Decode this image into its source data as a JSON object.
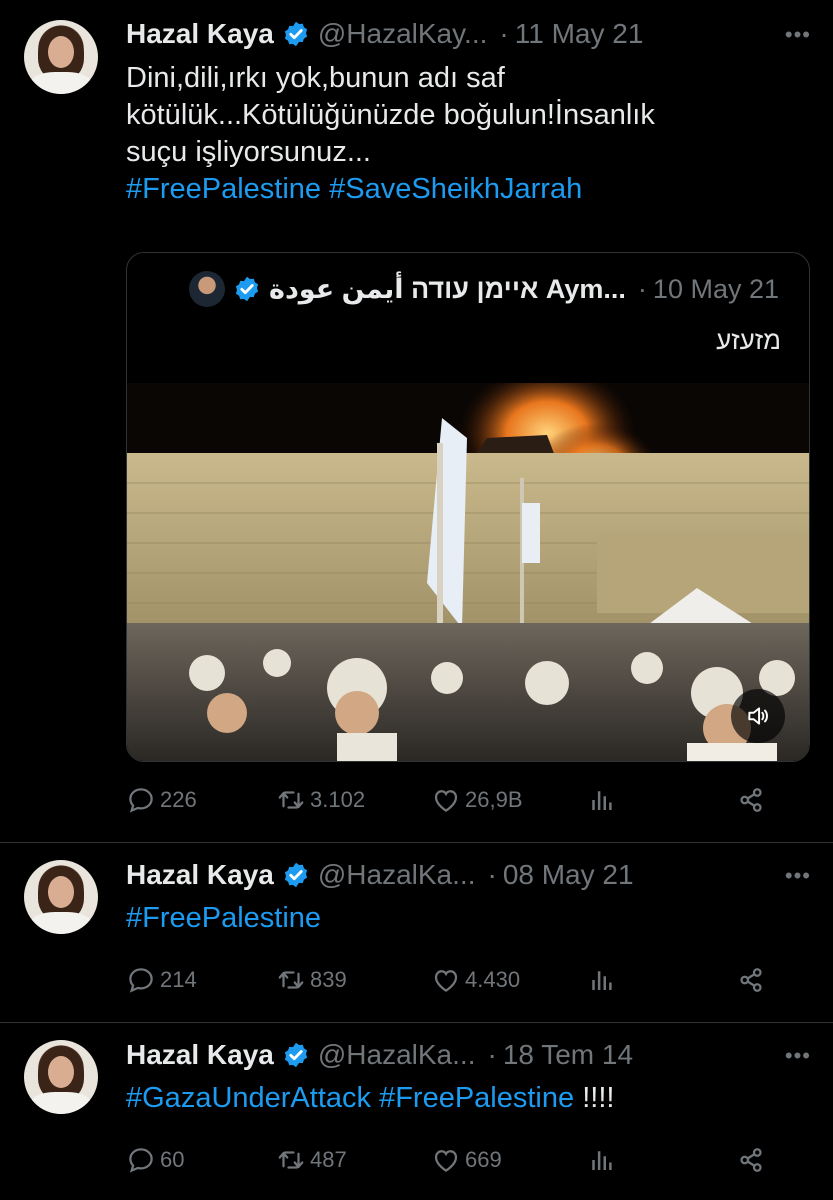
{
  "accent": "#1d9bf0",
  "tweets": [
    {
      "name": "Hazal Kaya",
      "handle": "@HazalKay...",
      "date": "11 May 21",
      "text_lines": [
        "Dini,dili,ırkı yok,bunun adı saf",
        "kötülük...Kötülüğünüzde boğulun!İnsanlık",
        "suçu işliyorsunuz..."
      ],
      "hashtags": [
        "#FreePalestine",
        "#SaveSheikhJarrah"
      ],
      "quote": {
        "name": "איימן עודה أيمن عودة Aym...",
        "date": "10 May 21",
        "text": "מזעזע"
      },
      "replies": "226",
      "retweets": "3.102",
      "likes": "26,9B"
    },
    {
      "name": "Hazal Kaya",
      "handle": "@HazalKa...",
      "date": "08 May 21",
      "hashtags": [
        "#FreePalestine"
      ],
      "replies": "214",
      "retweets": "839",
      "likes": "4.430"
    },
    {
      "name": "Hazal Kaya",
      "handle": "@HazalKa...",
      "date": "18 Tem 14",
      "hashtags": [
        "#GazaUnderAttack",
        "#FreePalestine"
      ],
      "trailing": "!!!!",
      "replies": "60",
      "retweets": "487",
      "likes": "669"
    }
  ],
  "icons": [
    "verified-badge-icon",
    "more-icon",
    "reply-icon",
    "retweet-icon",
    "like-icon",
    "views-icon",
    "share-icon",
    "sound-icon"
  ]
}
